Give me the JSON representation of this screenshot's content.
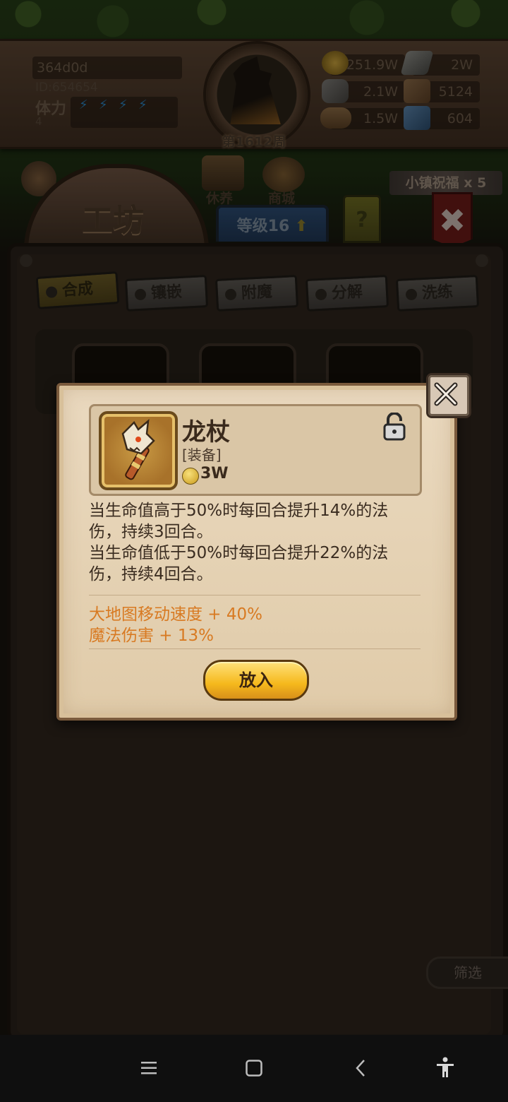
{
  "hud": {
    "username": "364d0d",
    "user_id": "ID:654654",
    "stamina_label": "体力",
    "stamina_value": "4",
    "week_label": "第1612周",
    "resources": [
      {
        "icon": "gold-coin-icon",
        "value": "251.9W"
      },
      {
        "icon": "iron-ingot-icon",
        "value": "2W"
      },
      {
        "icon": "stone-ore-icon",
        "value": "2.1W"
      },
      {
        "icon": "leather-icon",
        "value": "5124"
      },
      {
        "icon": "wood-log-icon",
        "value": "1.5W"
      },
      {
        "icon": "crystal-icon",
        "value": "604"
      }
    ]
  },
  "menu": {
    "rest_label": "休养",
    "shop_label": "商城"
  },
  "workshop": {
    "title": "工坊",
    "level_label": "等级16",
    "help_label": "?",
    "blessing_label": "小镇祝福 x 5",
    "close_label": "✖"
  },
  "tabs": [
    "合成",
    "镶嵌",
    "附魔",
    "分解",
    "洗练"
  ],
  "filter_label": "筛选",
  "popup": {
    "item_name": "龙杖",
    "item_type": "[装备]",
    "item_price": "3W",
    "description": [
      "当生命值高于50%时每回合提升14%的法伤，持续3回合。",
      "当生命值低于50%时每回合提升22%的法伤，持续4回合。"
    ],
    "stats": [
      "大地图移动速度 + 40%",
      "魔法伤害 + 13%"
    ],
    "place_button": "放入"
  },
  "colors": {
    "accent_orange": "#d87a22",
    "button_gold": "#f5b81c",
    "panel_bg": "#e0cba9"
  }
}
